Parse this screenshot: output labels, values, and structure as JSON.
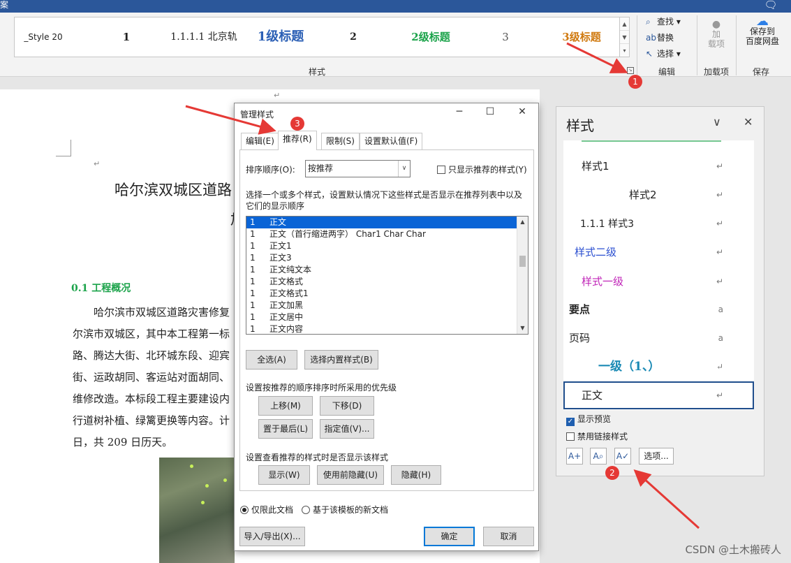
{
  "titlebar": {
    "title_char": "案"
  },
  "ribbon": {
    "style_gallery": [
      "_Style 20",
      "1",
      "1.1.1.1 北京轨",
      "1级标题",
      "2",
      "2级标题",
      "3",
      "3级标题"
    ],
    "styles_group_label": "样式",
    "edit_group": {
      "find": "查找",
      "replace": "替换",
      "select": "选择",
      "label": "编辑"
    },
    "addin_group": {
      "button": "加\n载项",
      "label": "加载项"
    },
    "save_group": {
      "button": "保存到\n百度网盘",
      "label": "保存"
    }
  },
  "document": {
    "title_line1": "哈尔滨双城区道路",
    "title_line2": "加",
    "heading": "0.1 工程概况",
    "lines": [
      "哈尔滨市双城区道路灾害修复",
      "尔滨市双城区，其中本工程第一标",
      "路、腾达大街、北环城东段、迎宾",
      "街、运政胡同、客运站对面胡同、",
      "维修改造。本标段工程主要建设内",
      "行道树补植、绿篱更换等内容。计",
      "日，共 209 日历天。"
    ]
  },
  "manage_styles_dialog": {
    "title": "管理样式",
    "tabs": [
      "编辑(E)",
      "推荐(R)",
      "限制(S)",
      "设置默认值(F)"
    ],
    "active_tab": "推荐(R)",
    "sort_label": "排序顺序(O):",
    "sort_value": "按推荐",
    "only_recommended": "只显示推荐的样式(Y)",
    "description": "选择一个或多个样式，设置默认情况下这些样式是否显示在推荐列表中以及它们的显示顺序",
    "style_list": [
      {
        "priority": "1",
        "name": "正文",
        "selected": true
      },
      {
        "priority": "1",
        "name": "正文（首行缩进两字） Char1 Char Char"
      },
      {
        "priority": "1",
        "name": "正文1"
      },
      {
        "priority": "1",
        "name": "正文3"
      },
      {
        "priority": "1",
        "name": "正文纯文本"
      },
      {
        "priority": "1",
        "name": "正文格式"
      },
      {
        "priority": "1",
        "name": "正文格式1"
      },
      {
        "priority": "1",
        "name": "正文加黑"
      },
      {
        "priority": "1",
        "name": "正文居中"
      },
      {
        "priority": "1",
        "name": "正文内容"
      }
    ],
    "select_all": "全选(A)",
    "select_builtin": "选择内置样式(B)",
    "priority_label": "设置按推荐的顺序排序时所采用的优先级",
    "move_up": "上移(M)",
    "move_down": "下移(D)",
    "move_last": "置于最后(L)",
    "assign_value": "指定值(V)...",
    "visibility_label": "设置查看推荐的样式时是否显示该样式",
    "show": "显示(W)",
    "hide_until_used": "使用前隐藏(U)",
    "hide": "隐藏(H)",
    "only_this_doc": "仅限此文档",
    "new_docs_template": "基于该模板的新文档",
    "import_export": "导入/导出(X)...",
    "ok": "确定",
    "cancel": "取消"
  },
  "styles_pane": {
    "title": "样式",
    "items": [
      {
        "name": "样式1",
        "mark": "↵"
      },
      {
        "name": "样式2",
        "mark": "↵"
      },
      {
        "name": "1.1.1  样式3",
        "mark": "↵"
      },
      {
        "name": "样式二级",
        "mark": "↵"
      },
      {
        "name": "样式一级",
        "mark": "↵"
      },
      {
        "name": "要点",
        "mark": "a"
      },
      {
        "name": "页码",
        "mark": "a"
      },
      {
        "name": "一级（1、）",
        "mark": "↵"
      },
      {
        "name": "正文",
        "mark": "↵"
      }
    ],
    "show_preview": "显示预览",
    "disable_linked": "禁用链接样式",
    "options_button": "选项..."
  },
  "annotations": [
    "1",
    "2",
    "3"
  ],
  "watermark": "CSDN @土木搬砖人",
  "colors": {
    "accent": "#2b579a",
    "heading_green": "#1ba34a",
    "annotation_red": "#e53935"
  }
}
